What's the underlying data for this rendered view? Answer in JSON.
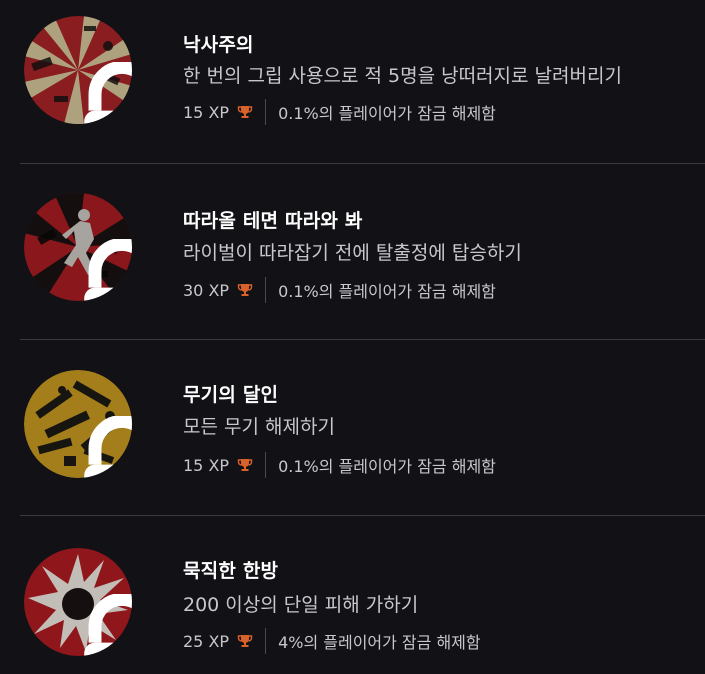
{
  "colors": {
    "background": "#111116",
    "trophy": "#d9622b",
    "title": "#ffffff",
    "text": "#c8c8cc"
  },
  "achievements": [
    {
      "title": "낙사주의",
      "description": "한 번의 그립 사용으로 적 5명을 낭떠러지로 날려버리기",
      "xp": "15 XP",
      "unlock_rate": "0.1%의 플레이어가 잠금 해제함",
      "locked": true,
      "badge_icon": "rising-sun-badge-icon"
    },
    {
      "title": "따라올 테면 따라와 봐",
      "description": "라이벌이 따라잡기 전에 탈출정에 탑승하기",
      "xp": "30 XP",
      "unlock_rate": "0.1%의 플레이어가 잠금 해제함",
      "locked": true,
      "badge_icon": "running-figure-badge-icon"
    },
    {
      "title": "무기의 달인",
      "description": "모든 무기 해제하기",
      "xp": "15 XP",
      "unlock_rate": "0.1%의 플레이어가 잠금 해제함",
      "locked": true,
      "badge_icon": "weapons-badge-icon"
    },
    {
      "title": "묵직한 한방",
      "description": "200 이상의 단일 피해 가하기",
      "xp": "25 XP",
      "unlock_rate": "4%의 플레이어가 잠금 해제함",
      "locked": true,
      "badge_icon": "impact-burst-badge-icon"
    }
  ]
}
